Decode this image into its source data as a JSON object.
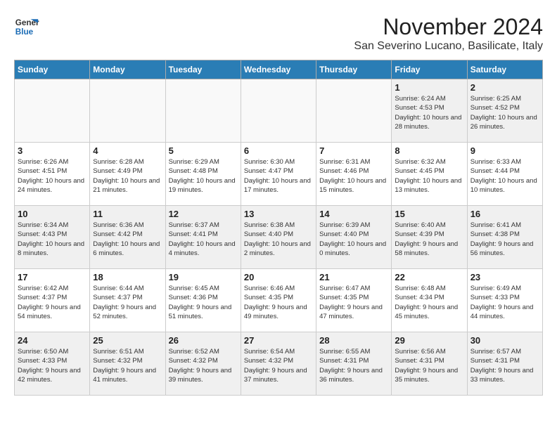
{
  "logo": {
    "line1": "General",
    "line2": "Blue"
  },
  "title": "November 2024",
  "location": "San Severino Lucano, Basilicate, Italy",
  "weekdays": [
    "Sunday",
    "Monday",
    "Tuesday",
    "Wednesday",
    "Thursday",
    "Friday",
    "Saturday"
  ],
  "weeks": [
    [
      {
        "day": "",
        "info": ""
      },
      {
        "day": "",
        "info": ""
      },
      {
        "day": "",
        "info": ""
      },
      {
        "day": "",
        "info": ""
      },
      {
        "day": "",
        "info": ""
      },
      {
        "day": "1",
        "info": "Sunrise: 6:24 AM\nSunset: 4:53 PM\nDaylight: 10 hours\nand 28 minutes."
      },
      {
        "day": "2",
        "info": "Sunrise: 6:25 AM\nSunset: 4:52 PM\nDaylight: 10 hours\nand 26 minutes."
      }
    ],
    [
      {
        "day": "3",
        "info": "Sunrise: 6:26 AM\nSunset: 4:51 PM\nDaylight: 10 hours\nand 24 minutes."
      },
      {
        "day": "4",
        "info": "Sunrise: 6:28 AM\nSunset: 4:49 PM\nDaylight: 10 hours\nand 21 minutes."
      },
      {
        "day": "5",
        "info": "Sunrise: 6:29 AM\nSunset: 4:48 PM\nDaylight: 10 hours\nand 19 minutes."
      },
      {
        "day": "6",
        "info": "Sunrise: 6:30 AM\nSunset: 4:47 PM\nDaylight: 10 hours\nand 17 minutes."
      },
      {
        "day": "7",
        "info": "Sunrise: 6:31 AM\nSunset: 4:46 PM\nDaylight: 10 hours\nand 15 minutes."
      },
      {
        "day": "8",
        "info": "Sunrise: 6:32 AM\nSunset: 4:45 PM\nDaylight: 10 hours\nand 13 minutes."
      },
      {
        "day": "9",
        "info": "Sunrise: 6:33 AM\nSunset: 4:44 PM\nDaylight: 10 hours\nand 10 minutes."
      }
    ],
    [
      {
        "day": "10",
        "info": "Sunrise: 6:34 AM\nSunset: 4:43 PM\nDaylight: 10 hours\nand 8 minutes."
      },
      {
        "day": "11",
        "info": "Sunrise: 6:36 AM\nSunset: 4:42 PM\nDaylight: 10 hours\nand 6 minutes."
      },
      {
        "day": "12",
        "info": "Sunrise: 6:37 AM\nSunset: 4:41 PM\nDaylight: 10 hours\nand 4 minutes."
      },
      {
        "day": "13",
        "info": "Sunrise: 6:38 AM\nSunset: 4:40 PM\nDaylight: 10 hours\nand 2 minutes."
      },
      {
        "day": "14",
        "info": "Sunrise: 6:39 AM\nSunset: 4:40 PM\nDaylight: 10 hours\nand 0 minutes."
      },
      {
        "day": "15",
        "info": "Sunrise: 6:40 AM\nSunset: 4:39 PM\nDaylight: 9 hours\nand 58 minutes."
      },
      {
        "day": "16",
        "info": "Sunrise: 6:41 AM\nSunset: 4:38 PM\nDaylight: 9 hours\nand 56 minutes."
      }
    ],
    [
      {
        "day": "17",
        "info": "Sunrise: 6:42 AM\nSunset: 4:37 PM\nDaylight: 9 hours\nand 54 minutes."
      },
      {
        "day": "18",
        "info": "Sunrise: 6:44 AM\nSunset: 4:37 PM\nDaylight: 9 hours\nand 52 minutes."
      },
      {
        "day": "19",
        "info": "Sunrise: 6:45 AM\nSunset: 4:36 PM\nDaylight: 9 hours\nand 51 minutes."
      },
      {
        "day": "20",
        "info": "Sunrise: 6:46 AM\nSunset: 4:35 PM\nDaylight: 9 hours\nand 49 minutes."
      },
      {
        "day": "21",
        "info": "Sunrise: 6:47 AM\nSunset: 4:35 PM\nDaylight: 9 hours\nand 47 minutes."
      },
      {
        "day": "22",
        "info": "Sunrise: 6:48 AM\nSunset: 4:34 PM\nDaylight: 9 hours\nand 45 minutes."
      },
      {
        "day": "23",
        "info": "Sunrise: 6:49 AM\nSunset: 4:33 PM\nDaylight: 9 hours\nand 44 minutes."
      }
    ],
    [
      {
        "day": "24",
        "info": "Sunrise: 6:50 AM\nSunset: 4:33 PM\nDaylight: 9 hours\nand 42 minutes."
      },
      {
        "day": "25",
        "info": "Sunrise: 6:51 AM\nSunset: 4:32 PM\nDaylight: 9 hours\nand 41 minutes."
      },
      {
        "day": "26",
        "info": "Sunrise: 6:52 AM\nSunset: 4:32 PM\nDaylight: 9 hours\nand 39 minutes."
      },
      {
        "day": "27",
        "info": "Sunrise: 6:54 AM\nSunset: 4:32 PM\nDaylight: 9 hours\nand 37 minutes."
      },
      {
        "day": "28",
        "info": "Sunrise: 6:55 AM\nSunset: 4:31 PM\nDaylight: 9 hours\nand 36 minutes."
      },
      {
        "day": "29",
        "info": "Sunrise: 6:56 AM\nSunset: 4:31 PM\nDaylight: 9 hours\nand 35 minutes."
      },
      {
        "day": "30",
        "info": "Sunrise: 6:57 AM\nSunset: 4:31 PM\nDaylight: 9 hours\nand 33 minutes."
      }
    ]
  ]
}
